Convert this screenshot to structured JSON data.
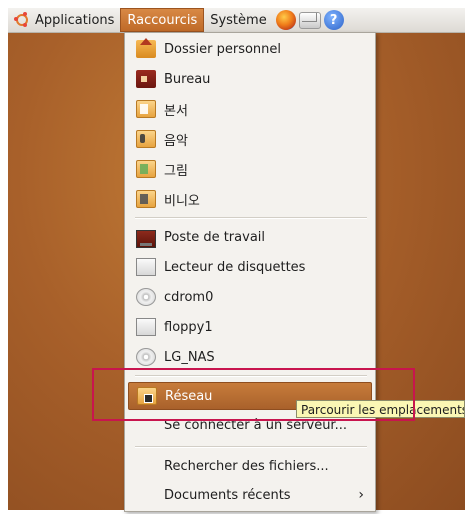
{
  "panel": {
    "applications": "Applications",
    "raccourcis": "Raccourcis",
    "systeme": "Système",
    "help_glyph": "?"
  },
  "menu": {
    "items": [
      {
        "label": "Dossier personnel",
        "icon": "home-folder-icon"
      },
      {
        "label": "Bureau",
        "icon": "desktop-folder-icon"
      },
      {
        "label": "본서",
        "icon": "folder-icon"
      },
      {
        "label": "음악",
        "icon": "music-folder-icon"
      },
      {
        "label": "그림",
        "icon": "pictures-folder-icon"
      },
      {
        "label": "비니오",
        "icon": "videos-folder-icon"
      },
      {
        "label": "Poste de travail",
        "icon": "computer-icon"
      },
      {
        "label": "Lecteur de disquettes",
        "icon": "floppy-drive-icon"
      },
      {
        "label": "cdrom0",
        "icon": "cdrom-icon"
      },
      {
        "label": "floppy1",
        "icon": "floppy-icon"
      },
      {
        "label": "LG_NAS",
        "icon": "cdrom-icon"
      },
      {
        "label": "Réseau",
        "icon": "network-folder-icon"
      },
      {
        "label": "Se connecter à un serveur..."
      },
      {
        "label": "Rechercher des fichiers..."
      },
      {
        "label": "Documents récents"
      }
    ],
    "submenu_arrow": "›"
  },
  "tooltip": "Parcourir les emplacements",
  "colors": {
    "accent": "#bf6a28",
    "highlight_box": "#c8154e",
    "tooltip_bg": "#fbf7b4"
  }
}
